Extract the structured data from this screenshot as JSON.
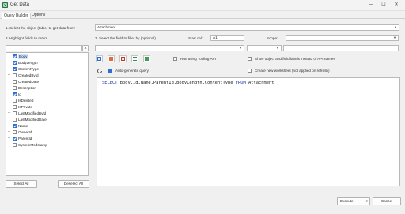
{
  "window": {
    "title": "Get Data",
    "minimize": "—",
    "maximize": "☐",
    "close": "✕"
  },
  "tabs": [
    {
      "label": "Query Builder",
      "active": true
    },
    {
      "label": "Options",
      "active": false
    }
  ],
  "step1": {
    "label": "1. Select the object (table) to get data from:",
    "value": "Attachment"
  },
  "step2": {
    "label": "2. Highlight fields to return",
    "search_value": "",
    "clear_label": "X"
  },
  "step3": {
    "label": "3. Select the field to filter by (optional)",
    "start_cell_label": "Start cell:",
    "start_cell_value": "A1",
    "scope_label": "Scope:",
    "scope_value": ""
  },
  "fields": [
    {
      "name": "Body",
      "checked": true,
      "selected": true,
      "expandable": false
    },
    {
      "name": "BodyLength",
      "checked": true,
      "selected": false,
      "expandable": false
    },
    {
      "name": "ContentType",
      "checked": true,
      "selected": false,
      "expandable": false
    },
    {
      "name": "CreatedById",
      "checked": false,
      "selected": false,
      "expandable": true
    },
    {
      "name": "CreatedDate",
      "checked": false,
      "selected": false,
      "expandable": false
    },
    {
      "name": "Description",
      "checked": false,
      "selected": false,
      "expandable": false
    },
    {
      "name": "Id",
      "checked": true,
      "selected": false,
      "expandable": false
    },
    {
      "name": "IsDeleted",
      "checked": false,
      "selected": false,
      "expandable": false
    },
    {
      "name": "IsPrivate",
      "checked": false,
      "selected": false,
      "expandable": false
    },
    {
      "name": "LastModifiedById",
      "checked": false,
      "selected": false,
      "expandable": true
    },
    {
      "name": "LastModifiedDate",
      "checked": false,
      "selected": false,
      "expandable": false
    },
    {
      "name": "Name",
      "checked": true,
      "selected": false,
      "expandable": false
    },
    {
      "name": "OwnerId",
      "checked": false,
      "selected": false,
      "expandable": true
    },
    {
      "name": "ParentId",
      "checked": true,
      "selected": false,
      "expandable": true
    },
    {
      "name": "SystemModstamp",
      "checked": false,
      "selected": false,
      "expandable": false
    }
  ],
  "buttons": {
    "select_all": "Select All",
    "deselect_all": "Deselect All",
    "execute": "Execute",
    "cancel": "Cancel"
  },
  "options": {
    "run_tooling_api": "Run using Tooling API",
    "show_labels": "Show object and field labels instead of API names",
    "auto_generate": "Auto-generate query",
    "create_worksheet": "Create new worksheet (not applied on refresh)"
  },
  "query": {
    "keyword_select": "SELECT",
    "fields_text": " Body,Id,Name,ParentId,BodyLength,ContentType ",
    "keyword_from": "FROM",
    "object_text": " Attachment"
  },
  "colors": {
    "accent": "#2b6fd6",
    "keyword": "#1a2fb0"
  }
}
